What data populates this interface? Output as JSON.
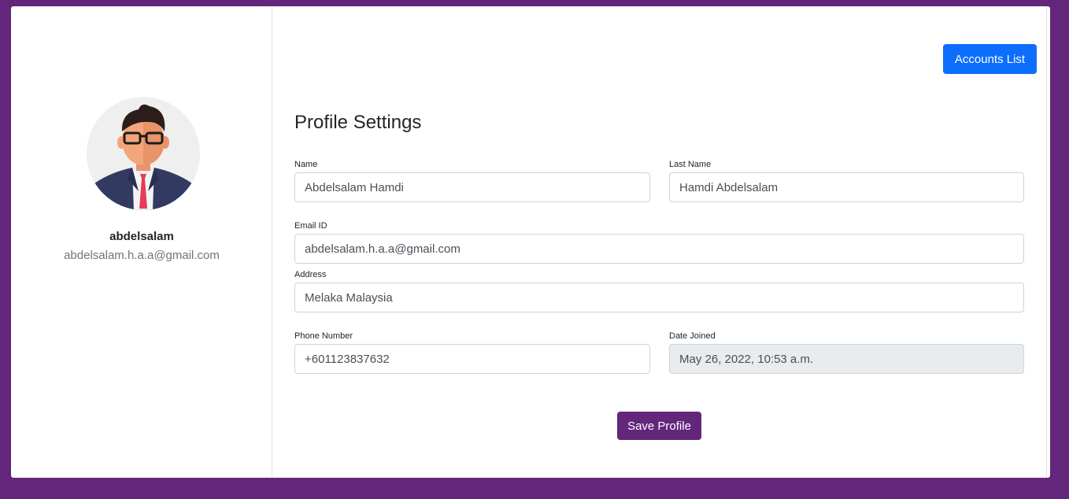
{
  "profile": {
    "username": "abdelsalam",
    "email": "abdelsalam.h.a.a@gmail.com"
  },
  "header": {
    "accounts_button": "Accounts List"
  },
  "form": {
    "title": "Profile Settings",
    "name": {
      "label": "Name",
      "value": "Abdelsalam Hamdi"
    },
    "last_name": {
      "label": "Last Name",
      "value": "Hamdi Abdelsalam"
    },
    "email": {
      "label": "Email ID",
      "value": "abdelsalam.h.a.a@gmail.com"
    },
    "address": {
      "label": "Address",
      "value": "Melaka Malaysia"
    },
    "phone": {
      "label": "Phone Number",
      "value": "+601123837632"
    },
    "date_joined": {
      "label": "Date Joined",
      "value": "May 26, 2022, 10:53 a.m."
    },
    "save_button": "Save Profile"
  },
  "colors": {
    "page_background": "#63267a",
    "primary_button": "#0d6efd",
    "save_button": "#63267a"
  },
  "icons": {
    "avatar": "businessman-avatar-icon"
  }
}
